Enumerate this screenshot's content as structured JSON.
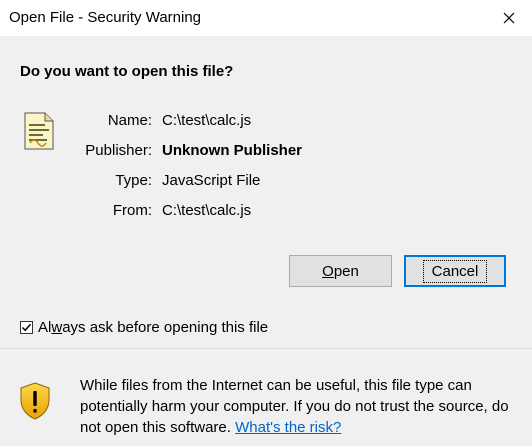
{
  "window": {
    "title": "Open File - Security Warning",
    "close_icon": "close-icon"
  },
  "question": "Do you want to open this file?",
  "file_icon": "script-file-icon",
  "details": {
    "name_label": "Name:",
    "name_value": "C:\\test\\calc.js",
    "publisher_label": "Publisher:",
    "publisher_value": "Unknown Publisher",
    "type_label": "Type:",
    "type_value": "JavaScript File",
    "from_label": "From:",
    "from_value": "C:\\test\\calc.js"
  },
  "buttons": {
    "open_label_pre": "",
    "open_label_mn": "O",
    "open_label_post": "pen",
    "cancel_label": "Cancel"
  },
  "checkbox": {
    "checked": true,
    "label_pre": "Al",
    "label_mn": "w",
    "label_post": "ays ask before opening this file"
  },
  "warning": {
    "icon": "shield-warning-icon",
    "text": "While files from the Internet can be useful, this file type can potentially harm your computer. If you do not trust the source, do not open this software.",
    "link_text": "What's the risk?"
  },
  "colors": {
    "background": "#f0f0f0",
    "link": "#0066cc",
    "focus_border": "#0078d7"
  }
}
